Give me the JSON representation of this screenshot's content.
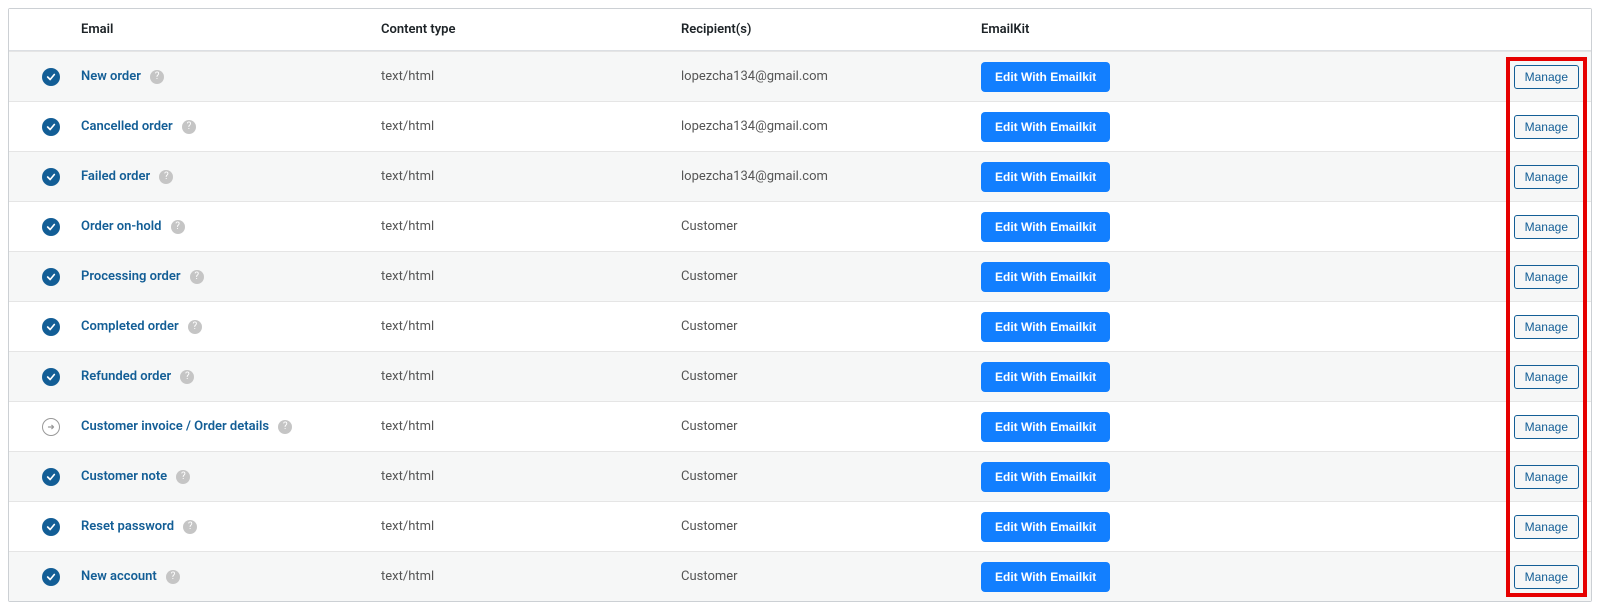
{
  "columns": {
    "status_blank": "",
    "email": "Email",
    "content_type": "Content type",
    "recipients": "Recipient(s)",
    "emailkit": "EmailKit",
    "manage_blank": ""
  },
  "labels": {
    "edit_with_emailkit": "Edit With Emailkit",
    "manage": "Manage",
    "help_glyph": "?"
  },
  "rows": [
    {
      "status": "enabled",
      "name": "New order",
      "content_type": "text/html",
      "recipient": "lopezcha134@gmail.com"
    },
    {
      "status": "enabled",
      "name": "Cancelled order",
      "content_type": "text/html",
      "recipient": "lopezcha134@gmail.com"
    },
    {
      "status": "enabled",
      "name": "Failed order",
      "content_type": "text/html",
      "recipient": "lopezcha134@gmail.com"
    },
    {
      "status": "enabled",
      "name": "Order on-hold",
      "content_type": "text/html",
      "recipient": "Customer"
    },
    {
      "status": "enabled",
      "name": "Processing order",
      "content_type": "text/html",
      "recipient": "Customer"
    },
    {
      "status": "enabled",
      "name": "Completed order",
      "content_type": "text/html",
      "recipient": "Customer"
    },
    {
      "status": "enabled",
      "name": "Refunded order",
      "content_type": "text/html",
      "recipient": "Customer"
    },
    {
      "status": "manual",
      "name": "Customer invoice / Order details",
      "content_type": "text/html",
      "recipient": "Customer"
    },
    {
      "status": "enabled",
      "name": "Customer note",
      "content_type": "text/html",
      "recipient": "Customer"
    },
    {
      "status": "enabled",
      "name": "Reset password",
      "content_type": "text/html",
      "recipient": "Customer"
    },
    {
      "status": "enabled",
      "name": "New account",
      "content_type": "text/html",
      "recipient": "Customer"
    }
  ]
}
